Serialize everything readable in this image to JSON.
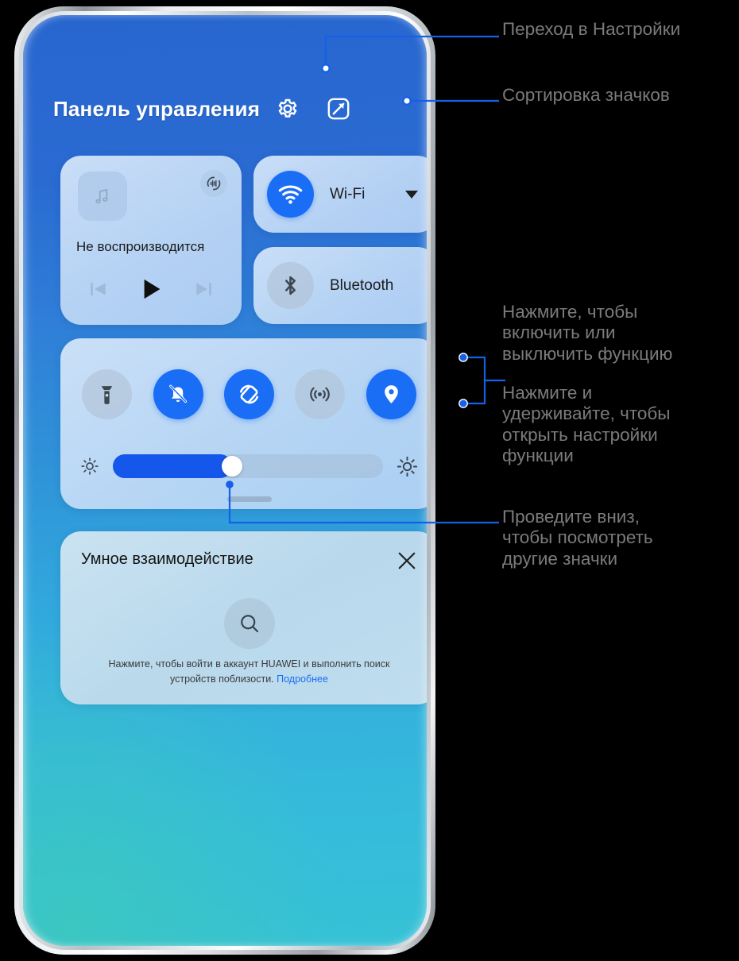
{
  "header": {
    "title": "Панель управления",
    "settings_icon": "gear-icon",
    "edit_icon": "edit-square-icon"
  },
  "media": {
    "album_icon": "music-note-icon",
    "cast_icon": "audio-output-icon",
    "status": "Не воспроизводится",
    "prev_label": "prev-track-icon",
    "play_label": "play-icon",
    "next_label": "next-track-icon"
  },
  "connectivity": [
    {
      "name": "wifi",
      "label": "Wi-Fi",
      "icon": "wifi-icon",
      "state": "on",
      "has_caret": true
    },
    {
      "name": "bluetooth",
      "label": "Bluetooth",
      "icon": "bluetooth-icon",
      "state": "off",
      "has_caret": false
    }
  ],
  "toggles": [
    {
      "name": "flashlight",
      "icon": "flashlight-icon",
      "state": "off"
    },
    {
      "name": "silent",
      "icon": "bell-muted-icon",
      "state": "on"
    },
    {
      "name": "auto-rotate",
      "icon": "auto-rotate-icon",
      "state": "on"
    },
    {
      "name": "hotspot",
      "icon": "hotspot-icon",
      "state": "off"
    },
    {
      "name": "location",
      "icon": "location-pin-icon",
      "state": "on"
    }
  ],
  "brightness": {
    "low_icon": "brightness-low-icon",
    "high_icon": "brightness-high-icon",
    "value_percent": 44
  },
  "grab_handle": "panel-drag-handle",
  "smart": {
    "title": "Умное взаимодействие",
    "close_icon": "close-icon",
    "search_icon": "search-icon",
    "description": "Нажмите, чтобы войти в аккаунт HUAWEI и выполнить поиск устройств поблизости.",
    "link": "Подробнее"
  },
  "annotations": [
    {
      "name": "annotation-open-settings",
      "text": "Переход в Настройки"
    },
    {
      "name": "annotation-sort-icons",
      "text": "Сортировка значков"
    },
    {
      "name": "annotation-tap-toggle",
      "text": "Нажмите, чтобы\nвключить или\nвыключить функцию"
    },
    {
      "name": "annotation-long-press",
      "text": "Нажмите и\nудерживайте, чтобы\nоткрыть настройки\nфункции"
    },
    {
      "name": "annotation-swipe-down",
      "text": "Проведите вниз,\nчтобы посмотреть\nдругие значки"
    }
  ],
  "colors": {
    "accent_blue": "#1a6ef5",
    "slider_blue": "#1557ea",
    "annotation_line": "#1560e6",
    "annotation_text": "#7b7b7b",
    "screen_top": "#2766cf",
    "screen_bottom": "#37c2d6"
  }
}
